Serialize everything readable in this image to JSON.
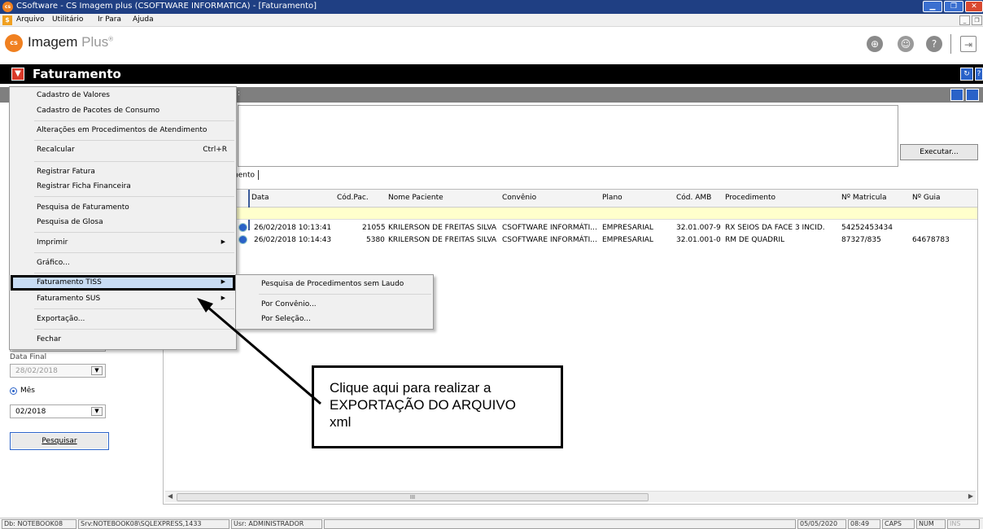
{
  "window": {
    "title": "CSoftware - CS Imagem plus (CSOFTWARE INFORMATICA) - [Faturamento]",
    "icon_text": "cs"
  },
  "menubar": {
    "icon_text": "$",
    "items": [
      "Arquivo",
      "Utilitário",
      "Ir Para",
      "Ajuda"
    ]
  },
  "app": {
    "logo_text": "cs",
    "logo_main": "Imagem",
    "logo_plus": "Plus",
    "logo_mark": "®"
  },
  "form": {
    "title": "Faturamento",
    "graybar_fragment": ":",
    "tab_label": "mento",
    "execute_label": "Executar..."
  },
  "grid": {
    "columns": [
      "Data",
      "Cód.Pac.",
      "Nome Paciente",
      "Convênio",
      "Plano",
      "Cód. AMB",
      "Procedimento",
      "Nº Matricula",
      "Nº Guia"
    ],
    "rows": [
      [
        "26/02/2018 10:13:41",
        "21055",
        "KRILERSON DE FREITAS SILVA",
        "CSOFTWARE INFORMÁTI...",
        "EMPRESARIAL",
        "32.01.007-9",
        "RX SEIOS DA FACE 3 INCID.",
        "54252453434",
        ""
      ],
      [
        "26/02/2018 10:14:43",
        "5380",
        "KRILERSON DE FREITAS SILVA",
        "CSOFTWARE INFORMÁTI...",
        "EMPRESARIAL",
        "32.01.001-0",
        "RM DE QUADRIL",
        "87327/835",
        "64678783"
      ]
    ],
    "scroll_thumb": "III"
  },
  "leftpanel": {
    "data_final_label": "Data Final",
    "data_final_value": "28/02/2018",
    "mes_label": "Mês",
    "mes_value": "02/2018",
    "search_label": "Pesquisar"
  },
  "context_menu": {
    "items": [
      {
        "label": "Cadastro de Valores"
      },
      {
        "label": "Cadastro de Pacotes de Consumo"
      },
      {
        "label": "Alterações em Procedimentos de Atendimento"
      },
      {
        "label": "Recalcular",
        "shortcut": "Ctrl+R"
      },
      {
        "label": "Registrar Fatura"
      },
      {
        "label": "Registrar Ficha Financeira"
      },
      {
        "label": "Pesquisa de Faturamento"
      },
      {
        "label": "Pesquisa de Glosa"
      },
      {
        "label": "Imprimir"
      },
      {
        "label": "Gráfico..."
      },
      {
        "label": "Faturamento TISS"
      },
      {
        "label": "Faturamento SUS"
      },
      {
        "label": "Exportação..."
      },
      {
        "label": "Fechar"
      }
    ]
  },
  "submenu": {
    "items": [
      "Pesquisa de Procedimentos sem Laudo",
      "Por Convênio...",
      "Por Seleção..."
    ]
  },
  "callout": {
    "text": "Clique aqui para realizar a EXPORTAÇÃO DO ARQUIVO xml"
  },
  "statusbar": {
    "db": "Db: NOTEBOOK08",
    "srv": "Srv:NOTEBOOK08\\SQLEXPRESS,1433",
    "usr": "Usr: ADMINISTRADOR",
    "date": "05/05/2020",
    "time": "08:49",
    "caps": "CAPS",
    "num": "NUM",
    "ins": "INS"
  },
  "colors": {
    "titlebar": "#1f3f83",
    "menu_highlight": "#c8dcf4",
    "grid_filter_row": "#ffffcc",
    "accent_orange": "#f08020"
  }
}
